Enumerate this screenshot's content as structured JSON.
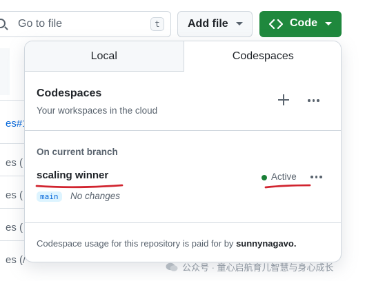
{
  "toolbar": {
    "goto_placeholder": "Go to file",
    "goto_shortcut": "t",
    "add_file_label": "Add file",
    "code_label": "Code",
    "code_color": "#1f883d"
  },
  "background_rows": [
    {
      "text": "es#1",
      "link": true
    },
    {
      "text": "es (",
      "link": false
    },
    {
      "text": "es (",
      "link": false
    },
    {
      "text": "es (",
      "link": false
    },
    {
      "text": "es (/",
      "link": false
    }
  ],
  "panel": {
    "tabs": [
      {
        "label": "Local",
        "active": false
      },
      {
        "label": "Codespaces",
        "active": true
      }
    ],
    "codespaces_title": "Codespaces",
    "codespaces_subtitle": "Your workspaces in the cloud",
    "branch_heading": "On current branch",
    "codespace": {
      "name": "scaling winner",
      "branch": "main",
      "changes": "No changes",
      "status": "Active",
      "status_color": "#1a7f37"
    },
    "footer": {
      "text": "Codespace usage for this repository is paid for by",
      "owner": "sunnynagavo."
    }
  },
  "annotation_color": "#d1242f",
  "watermark": "公众号 · 童心启航育儿智慧与身心成长"
}
